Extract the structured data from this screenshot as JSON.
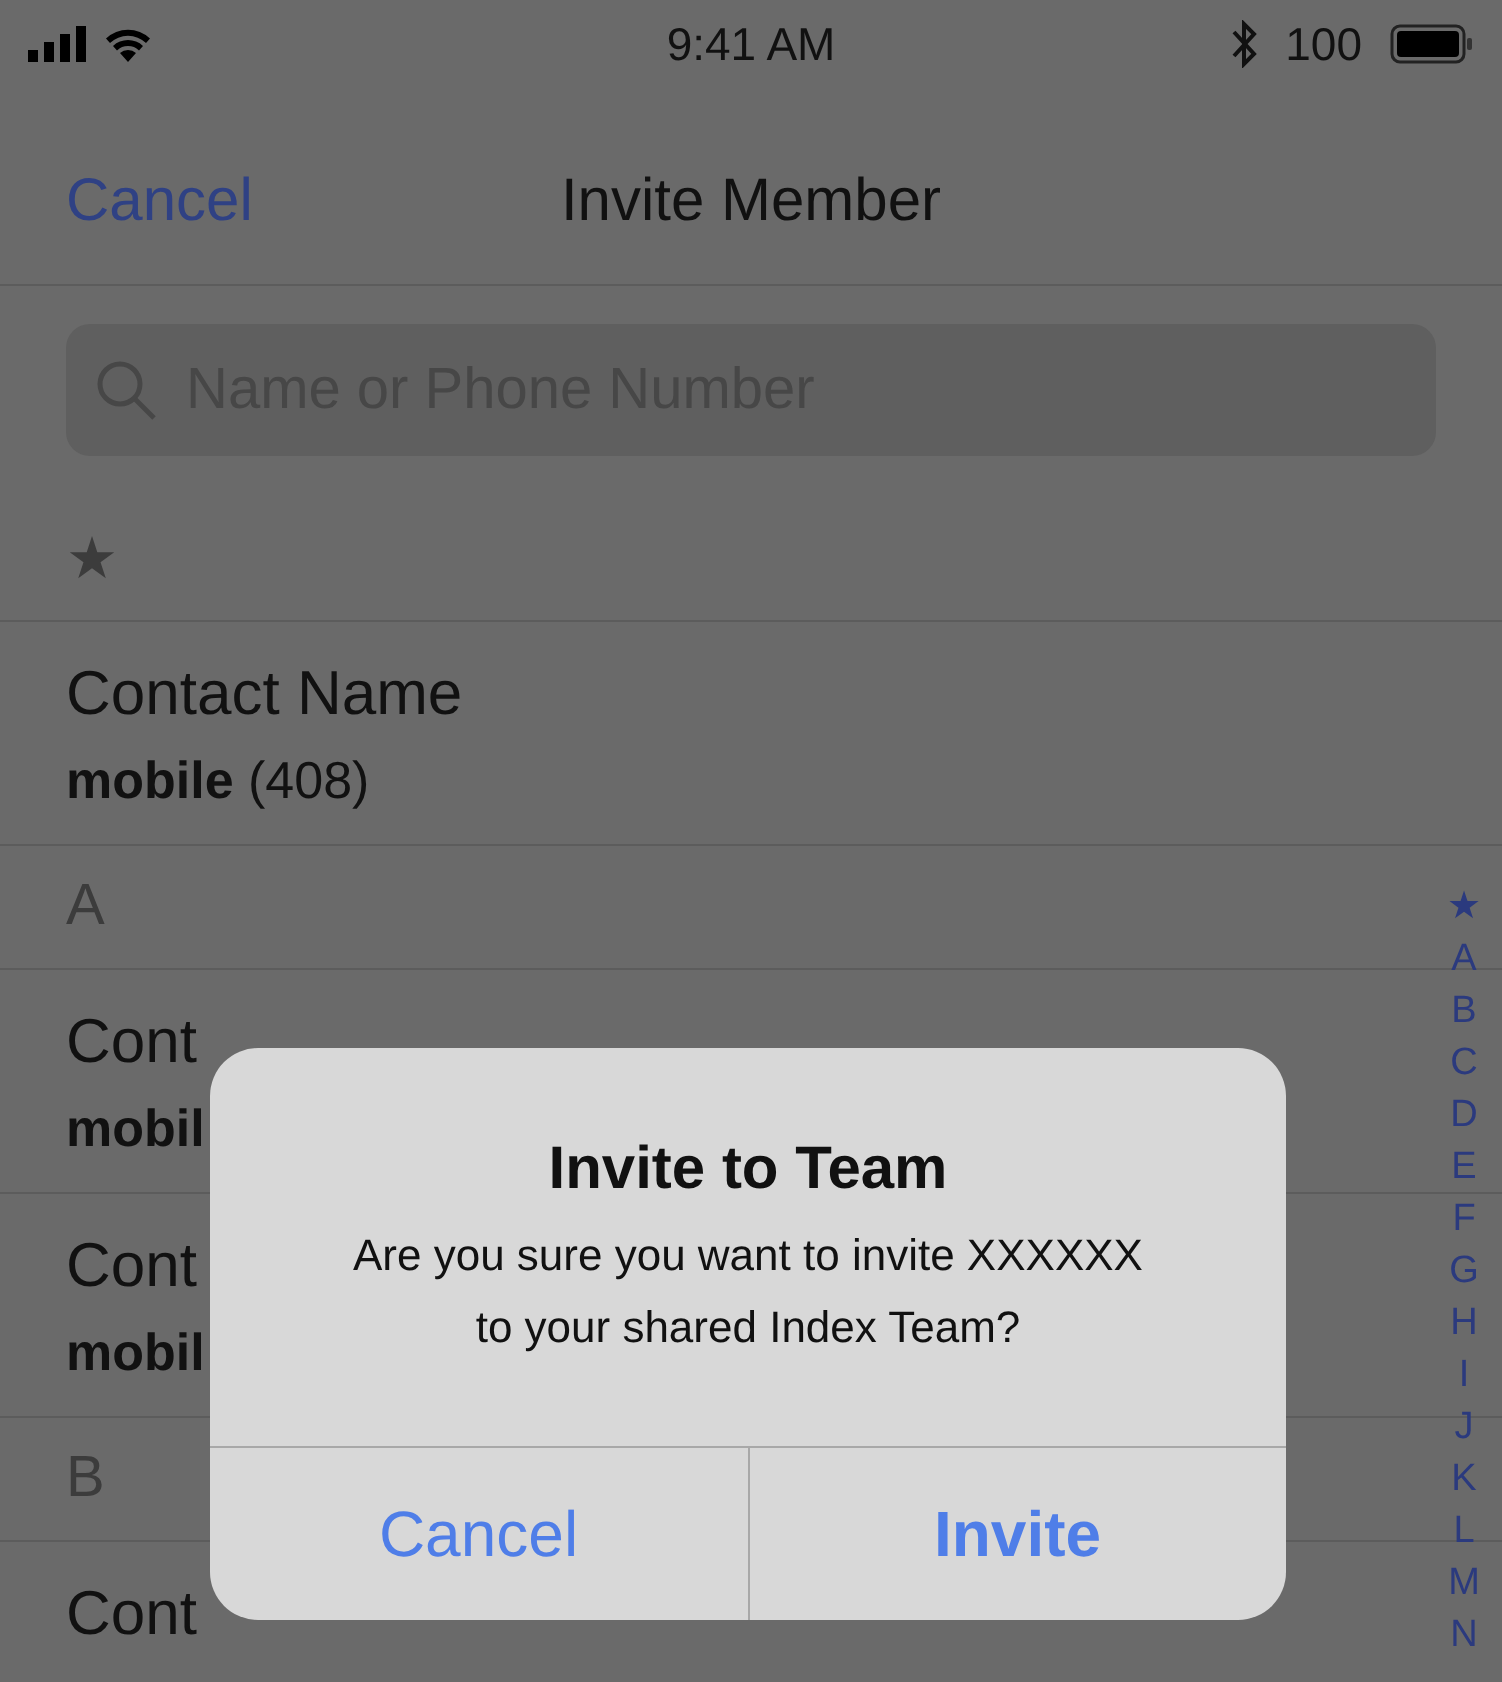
{
  "status_bar": {
    "time": "9:41 AM",
    "battery": "100"
  },
  "nav_bar": {
    "cancel": "Cancel",
    "title": "Invite Member"
  },
  "search": {
    "placeholder": "Name or Phone Number"
  },
  "contacts": [
    {
      "kind": "section",
      "label": "★"
    },
    {
      "kind": "contact",
      "name": "Contact Name",
      "phone_label": "mobile",
      "phone": "(408)"
    },
    {
      "kind": "section",
      "label": "A"
    },
    {
      "kind": "contact",
      "name": "Cont",
      "phone_label": "mobil"
    },
    {
      "kind": "contact",
      "name": "Cont",
      "phone_label": "mobil"
    },
    {
      "kind": "section",
      "label": "B"
    },
    {
      "kind": "contact",
      "name": "Cont"
    }
  ],
  "index": [
    "★",
    "A",
    "B",
    "C",
    "D",
    "E",
    "F",
    "G",
    "H",
    "I",
    "J",
    "K",
    "L",
    "M",
    "N"
  ],
  "alert": {
    "title": "Invite to Team",
    "message": "Are you sure you want to invite XXXXXX to your shared Index Team?",
    "buttons": [
      {
        "label": "Cancel",
        "kind": "cancel"
      },
      {
        "label": "Invite",
        "kind": "default"
      }
    ]
  }
}
